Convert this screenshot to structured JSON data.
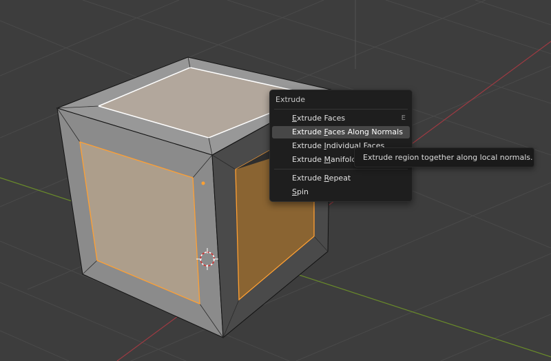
{
  "menu": {
    "title": "Extrude",
    "items": [
      {
        "pre": "",
        "ul": "E",
        "post": "xtrude Faces",
        "shortcut": "E",
        "active": false
      },
      {
        "pre": "Extrude ",
        "ul": "F",
        "post": "aces Along Normals",
        "shortcut": "",
        "active": true
      },
      {
        "pre": "Extrude ",
        "ul": "I",
        "post": "ndividual Faces",
        "shortcut": "",
        "active": false
      },
      {
        "pre": "Extrude ",
        "ul": "M",
        "post": "anifold",
        "shortcut": "",
        "active": false
      },
      {
        "pre": "Extrude ",
        "ul": "R",
        "post": "epeat",
        "shortcut": "",
        "active": false
      },
      {
        "pre": "",
        "ul": "S",
        "post": "pin",
        "shortcut": "",
        "active": false
      }
    ]
  },
  "tooltip": {
    "text": "Extrude region together along local normals."
  },
  "colors": {
    "background": "#3d3d3d",
    "selection": "#ffa033",
    "x_axis": "#9e3a42",
    "y_axis": "#6a8c2a"
  }
}
